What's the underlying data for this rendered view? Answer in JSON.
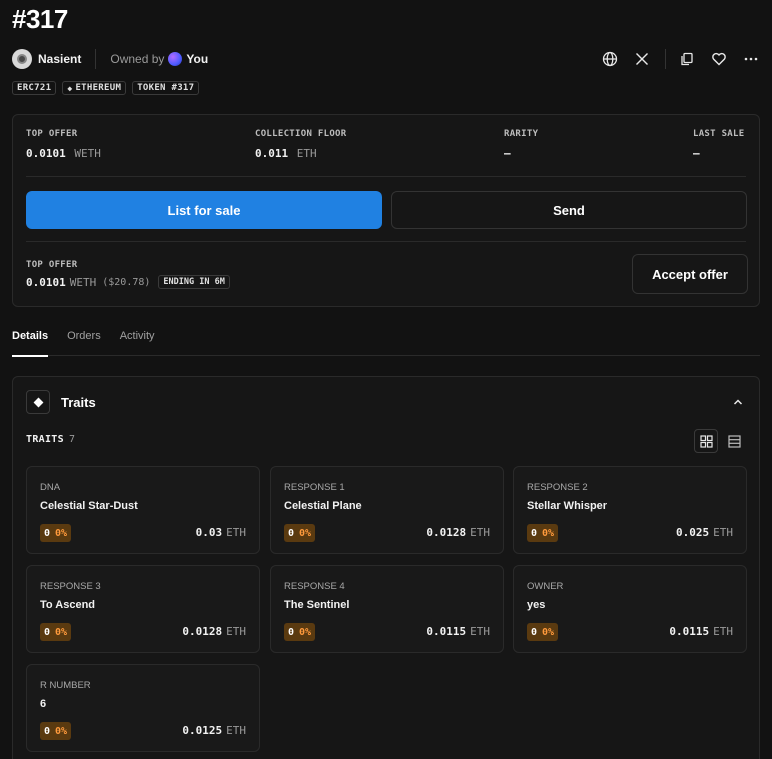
{
  "title": "#317",
  "collection": {
    "name": "Nasient"
  },
  "owner": {
    "label": "Owned by",
    "name": "You"
  },
  "top_actions": [
    "globe-icon",
    "x-icon",
    "copy-icon",
    "heart-icon",
    "more-icon"
  ],
  "badges": {
    "standard": "ERC721",
    "chain": "ETHEREUM",
    "token": "TOKEN #317"
  },
  "stats": {
    "top_offer": {
      "label": "TOP OFFER",
      "value": "0.0101",
      "unit": "WETH"
    },
    "collection_floor": {
      "label": "COLLECTION FLOOR",
      "value": "0.011",
      "unit": "ETH"
    },
    "rarity": {
      "label": "RARITY",
      "value": "–"
    },
    "last_sale": {
      "label": "LAST SALE",
      "value": "–"
    }
  },
  "buttons": {
    "list_for_sale": "List for sale",
    "send": "Send",
    "accept_offer": "Accept offer"
  },
  "offer": {
    "label": "TOP OFFER",
    "amount": "0.0101",
    "unit": "WETH",
    "usd": "($20.78)",
    "ending": "ENDING IN 6M"
  },
  "tabs": [
    {
      "label": "Details"
    },
    {
      "label": "Orders"
    },
    {
      "label": "Activity"
    }
  ],
  "traits": {
    "title": "Traits",
    "label": "TRAITS",
    "count": "7",
    "items": [
      {
        "type": "DNA",
        "value": "Celestial Star-Dust",
        "count": "0",
        "percent": "0%",
        "price": "0.03",
        "currency": "ETH"
      },
      {
        "type": "RESPONSE 1",
        "value": "Celestial Plane",
        "count": "0",
        "percent": "0%",
        "price": "0.0128",
        "currency": "ETH"
      },
      {
        "type": "RESPONSE 2",
        "value": "Stellar Whisper",
        "count": "0",
        "percent": "0%",
        "price": "0.025",
        "currency": "ETH"
      },
      {
        "type": "RESPONSE 3",
        "value": "To Ascend",
        "count": "0",
        "percent": "0%",
        "price": "0.0128",
        "currency": "ETH"
      },
      {
        "type": "RESPONSE 4",
        "value": "The Sentinel",
        "count": "0",
        "percent": "0%",
        "price": "0.0115",
        "currency": "ETH"
      },
      {
        "type": "OWNER",
        "value": "yes",
        "count": "0",
        "percent": "0%",
        "price": "0.0115",
        "currency": "ETH"
      },
      {
        "type": "R NUMBER",
        "value": "6",
        "count": "0",
        "percent": "0%",
        "price": "0.0125",
        "currency": "ETH"
      }
    ]
  },
  "colors": {
    "primary": "#2081e2",
    "rarity_bg": "#5a3a10",
    "rarity_text": "#ff9a3c",
    "background": "#121212"
  }
}
